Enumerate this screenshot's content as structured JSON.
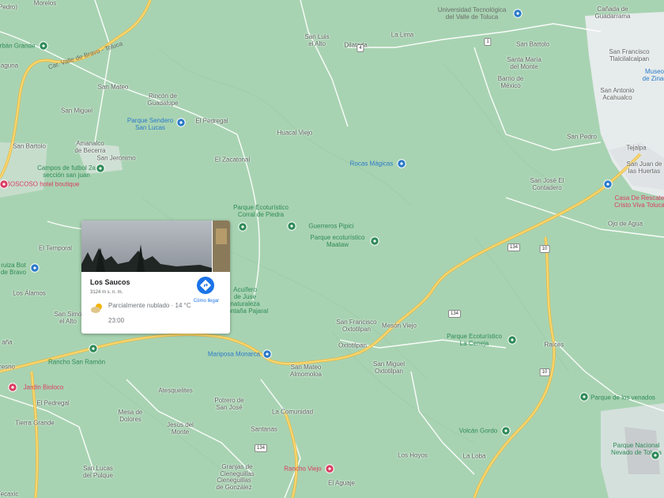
{
  "map": {
    "colors": {
      "terrain": "#a8d3b2",
      "urban": "#e9ecee",
      "highway": "#f6d36f",
      "road": "#ffffff",
      "park": "#8fcb9e",
      "poi_green": "#2e8a57",
      "poi_blue": "#2b7ac9",
      "poi_pink": "#d93e63"
    },
    "places": [
      {
        "id": "morelos",
        "text": "Morelos",
        "style": "hl"
      },
      {
        "id": "pedro",
        "text": "Pedro)",
        "style": "hl"
      },
      {
        "id": "san-luis-el-alto",
        "text": "San Luis\nel Alto",
        "style": "hl"
      },
      {
        "id": "dilatada",
        "text": "Dilatada",
        "style": "hl"
      },
      {
        "id": "la-lima",
        "text": "La Lima",
        "style": "hl"
      },
      {
        "id": "universidad",
        "text": "Universidad Tecnológica\ndel Valle de Toluca",
        "style": "poi-gray"
      },
      {
        "id": "canada",
        "text": "Cañada de\nGuadarrama",
        "style": "hl"
      },
      {
        "id": "san-bartolo-n",
        "text": "San Bartolo",
        "style": "hl"
      },
      {
        "id": "san-francisco-tlal",
        "text": "San Francisco\nTlalcilalcalpan",
        "style": "hl"
      },
      {
        "id": "museo",
        "text": "Museo\nde Zinac",
        "style": "poi-blue"
      },
      {
        "id": "santa-maria",
        "text": "Santa María\ndel Monte",
        "style": "hl"
      },
      {
        "id": "barrio",
        "text": "Barrio de\nMéxico",
        "style": "hl"
      },
      {
        "id": "san-antonio",
        "text": "San Antonio\nAcahualco",
        "style": "hl"
      },
      {
        "id": "urban-grande",
        "text": "rbán Grande",
        "style": "poi-green"
      },
      {
        "id": "laguna",
        "text": "aguna",
        "style": "hl"
      },
      {
        "id": "san-mateo",
        "text": "San Mateo",
        "style": "hl"
      },
      {
        "id": "rincon",
        "text": "Rincón de\nGuadalupe",
        "style": "hl"
      },
      {
        "id": "san-miguel",
        "text": "San Miguel",
        "style": "hl"
      },
      {
        "id": "parque-sendero",
        "text": "Parque Sendero\nSan Lucas",
        "style": "poi-blue"
      },
      {
        "id": "el-pedregal-n",
        "text": "El Pedregal",
        "style": "hl"
      },
      {
        "id": "huacal-viejo",
        "text": "Huacal Viejo",
        "style": "hl"
      },
      {
        "id": "san-pedro",
        "text": "San Pedro",
        "style": "hl"
      },
      {
        "id": "tejalpa",
        "text": "Tejalpa",
        "style": "hl"
      },
      {
        "id": "san-bartolo-w",
        "text": "San Bartolo",
        "style": "hl"
      },
      {
        "id": "amanalco",
        "text": "Amanalco\nde Becerra",
        "style": "hl"
      },
      {
        "id": "san-jeronimo",
        "text": "San Jerónimo",
        "style": "hl"
      },
      {
        "id": "el-zacatonal",
        "text": "El Zacatonal",
        "style": "hl"
      },
      {
        "id": "rocas-magicas",
        "text": "Rocas Mágicas",
        "style": "poi-blue"
      },
      {
        "id": "san-juan-huertas",
        "text": "San Juan de\nlas Huertas",
        "style": "hl"
      },
      {
        "id": "campos-futbol",
        "text": "Campos de futbol 2a\nsección san juan",
        "style": "poi-green"
      },
      {
        "id": "bosqoso",
        "text": "BOSCOSO hotel boutique",
        "style": "poi-pink"
      },
      {
        "id": "san-jose-contadero",
        "text": "San José El\nContadero",
        "style": "hl"
      },
      {
        "id": "casa-rescate",
        "text": "Casa De Rescate\nCristo Viva Toluca",
        "style": "poi-pink"
      },
      {
        "id": "parque-corral",
        "text": "Parque Ecoturístico\nCorral de Piedra",
        "style": "poi-green"
      },
      {
        "id": "guerreros",
        "text": "Guerreros Pipici",
        "style": "poi-green"
      },
      {
        "id": "parque-maataw",
        "text": "Parque ecoturístico\nMaataw",
        "style": "poi-green"
      },
      {
        "id": "ojo-de-agua",
        "text": "Ojo de Agua",
        "style": "hl"
      },
      {
        "id": "el-temporal",
        "text": "El Temporal",
        "style": "hl"
      },
      {
        "id": "ruiza",
        "text": "ruiza Bot\nde Bravo",
        "style": "poi-green"
      },
      {
        "id": "los-alamos",
        "text": "Los Álamos",
        "style": "hl"
      },
      {
        "id": "san-simon",
        "text": "San Simó\nel Alto",
        "style": "hl"
      },
      {
        "id": "acuifero",
        "text": "Acuífero\nde Juse\nnaturaleza\nMontaña Pajaral",
        "style": "poi-green"
      },
      {
        "id": "san-francisco-oxto",
        "text": "San Francisco\nOxtotilpan",
        "style": "hl"
      },
      {
        "id": "meson-viejo",
        "text": "Mesón Viejo",
        "style": "hl"
      },
      {
        "id": "oxtotilpan",
        "text": "Oxtotilpan",
        "style": "hl"
      },
      {
        "id": "parque-ceneja",
        "text": "Parque Ecoturístico\nLa Ceneja",
        "style": "poi-green"
      },
      {
        "id": "ana",
        "text": "aña",
        "style": "hl"
      },
      {
        "id": "raices",
        "text": "Raíces",
        "style": "hl"
      },
      {
        "id": "rancho-san-ramon",
        "text": "Rancho San Ramón",
        "style": "poi-green"
      },
      {
        "id": "mariposa-monarca",
        "text": "Mariposa Monarca",
        "style": "poi-blue"
      },
      {
        "id": "san-mateo-almomoloa",
        "text": "San Mateo\nAlmomoloa",
        "style": "hl"
      },
      {
        "id": "san-miguel-oxto",
        "text": "San Miguel\nOxtotilpan",
        "style": "hl"
      },
      {
        "id": "eresno",
        "text": "resno",
        "style": "hl"
      },
      {
        "id": "jardin-bioloco",
        "text": "Jardín Bioloco",
        "style": "poi-pink"
      },
      {
        "id": "atesquelites",
        "text": "Atesquelites",
        "style": "hl"
      },
      {
        "id": "parque-venados",
        "text": "Parque de los venados",
        "style": "poi-green"
      },
      {
        "id": "el-pedregal-s",
        "text": "El Pedregal",
        "style": "hl"
      },
      {
        "id": "potrero",
        "text": "Potrero de\nSan José",
        "style": "hl"
      },
      {
        "id": "mesa-dolores",
        "text": "Mesa de\nDolores",
        "style": "hl"
      },
      {
        "id": "la-comunidad",
        "text": "La Comunidad",
        "style": "hl"
      },
      {
        "id": "tierra-grande",
        "text": "Tierra Grande",
        "style": "hl"
      },
      {
        "id": "jesus-monte",
        "text": "Jesús del\nMonte",
        "style": "hl"
      },
      {
        "id": "santanas",
        "text": "Santanas",
        "style": "hl"
      },
      {
        "id": "volcan-gordo",
        "text": "Volcán Gordo",
        "style": "poi-green"
      },
      {
        "id": "parque-nacional",
        "text": "Parque Nacional\nNevado de Toluca",
        "style": "poi-green"
      },
      {
        "id": "los-hoyos",
        "text": "Los Hoyos",
        "style": "hl"
      },
      {
        "id": "la-loba",
        "text": "La Loba",
        "style": "hl"
      },
      {
        "id": "rancho-viejo",
        "text": "Rancho Viejo",
        "style": "poi-pink"
      },
      {
        "id": "san-lucas",
        "text": "San Lucas\ndel Pulque",
        "style": "hl"
      },
      {
        "id": "granjas",
        "text": "Granjas de\nCieneguillas",
        "style": "hl"
      },
      {
        "id": "cieneguillas",
        "text": "Cieneguillas\nde González",
        "style": "hl"
      },
      {
        "id": "el-aguaje",
        "text": "El Aguaje",
        "style": "hl"
      },
      {
        "id": "tecaxic",
        "text": "Tecaxic",
        "style": "hl"
      },
      {
        "id": "road-valle",
        "text": "Car. Valle de Bravo - Toluca",
        "style": "poi-gray"
      }
    ],
    "shields": [
      {
        "id": "shield-134-a",
        "text": "134"
      },
      {
        "id": "shield-134-b",
        "text": "134"
      },
      {
        "id": "shield-134-c",
        "text": "134"
      },
      {
        "id": "shield-10-a",
        "text": "10"
      },
      {
        "id": "shield-10-b",
        "text": "10"
      },
      {
        "id": "shield-1",
        "text": "1"
      },
      {
        "id": "shield-4",
        "text": "4"
      }
    ]
  },
  "card": {
    "title": "Los Saucos",
    "elevation": "3124 m s. n. m.",
    "weather": "Parcialmente nublado · 14 °C",
    "time": "23:00",
    "directions_label": "Cómo llegar",
    "weather_icon": "partly-cloudy-icon",
    "directions_icon": "directions-icon"
  }
}
